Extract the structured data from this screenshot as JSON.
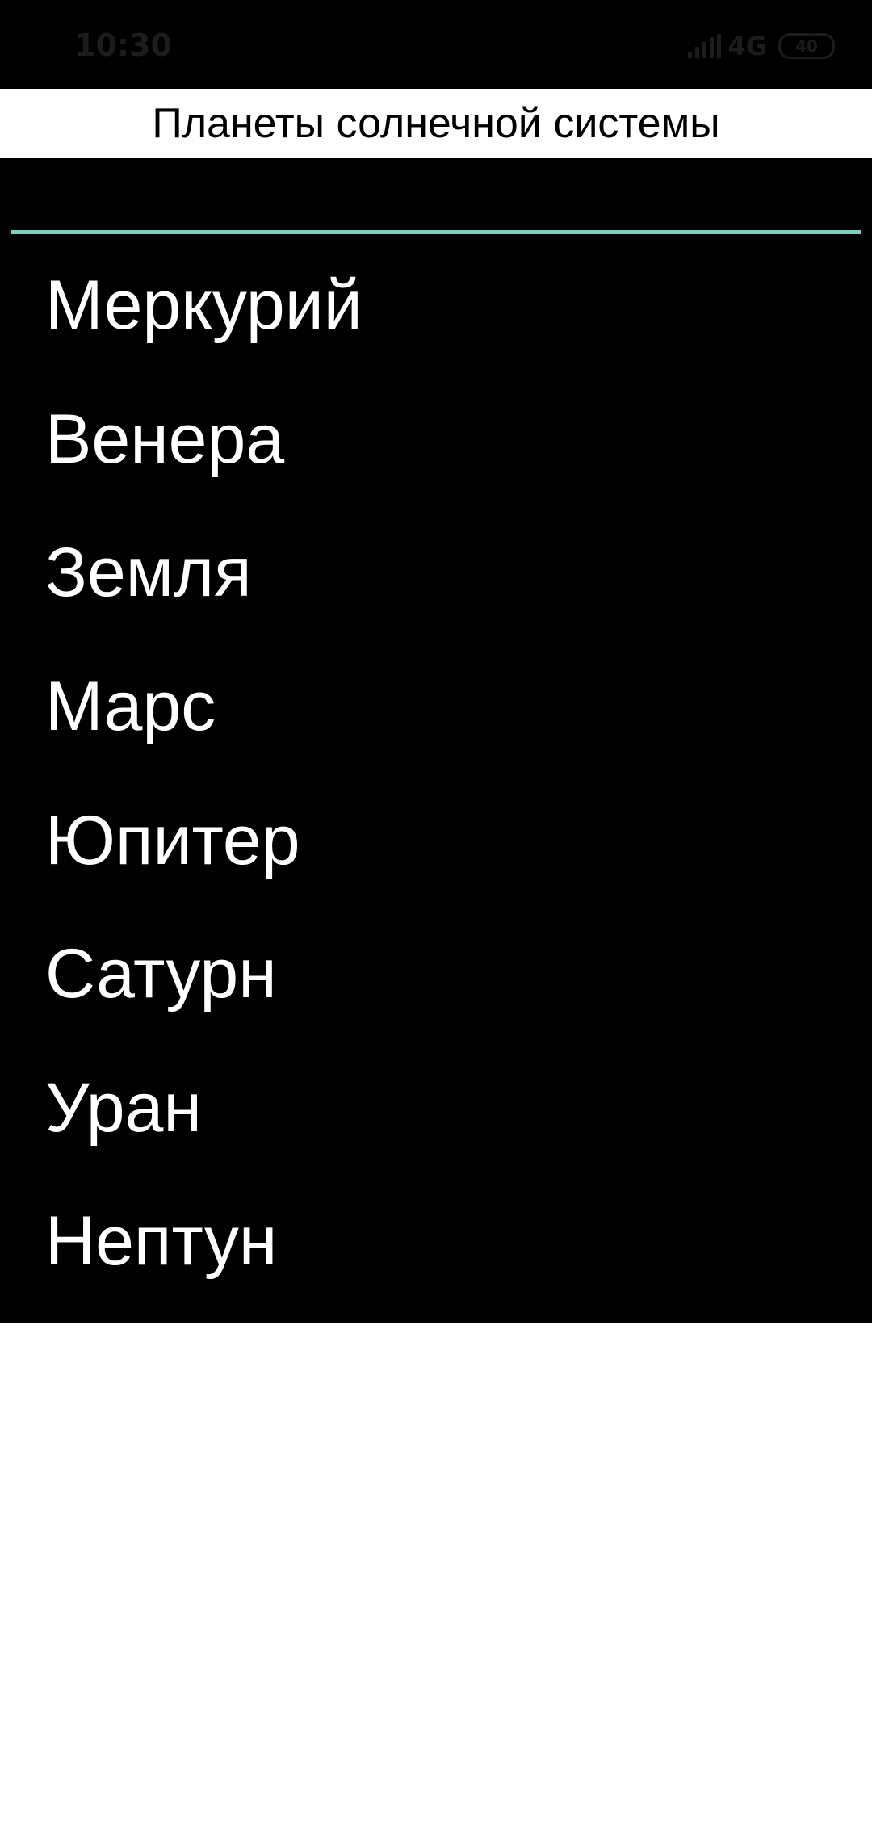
{
  "status_bar": {
    "time": "10:30",
    "network": "4G",
    "battery_level": "40",
    "icons": [
      "signal-icon",
      "battery-icon"
    ]
  },
  "header": {
    "title": "Планеты солнечной системы"
  },
  "search": {
    "value": "",
    "placeholder": "",
    "underline_color": "#7fcdc4"
  },
  "planets": [
    {
      "label": "Меркурий"
    },
    {
      "label": "Венера"
    },
    {
      "label": "Земля"
    },
    {
      "label": "Марс"
    },
    {
      "label": "Юпитер"
    },
    {
      "label": "Сатурн"
    },
    {
      "label": "Уран"
    },
    {
      "label": "Нептун"
    }
  ],
  "colors": {
    "list_background": "#000000",
    "list_text": "#ffffff",
    "page_background": "#ffffff"
  }
}
